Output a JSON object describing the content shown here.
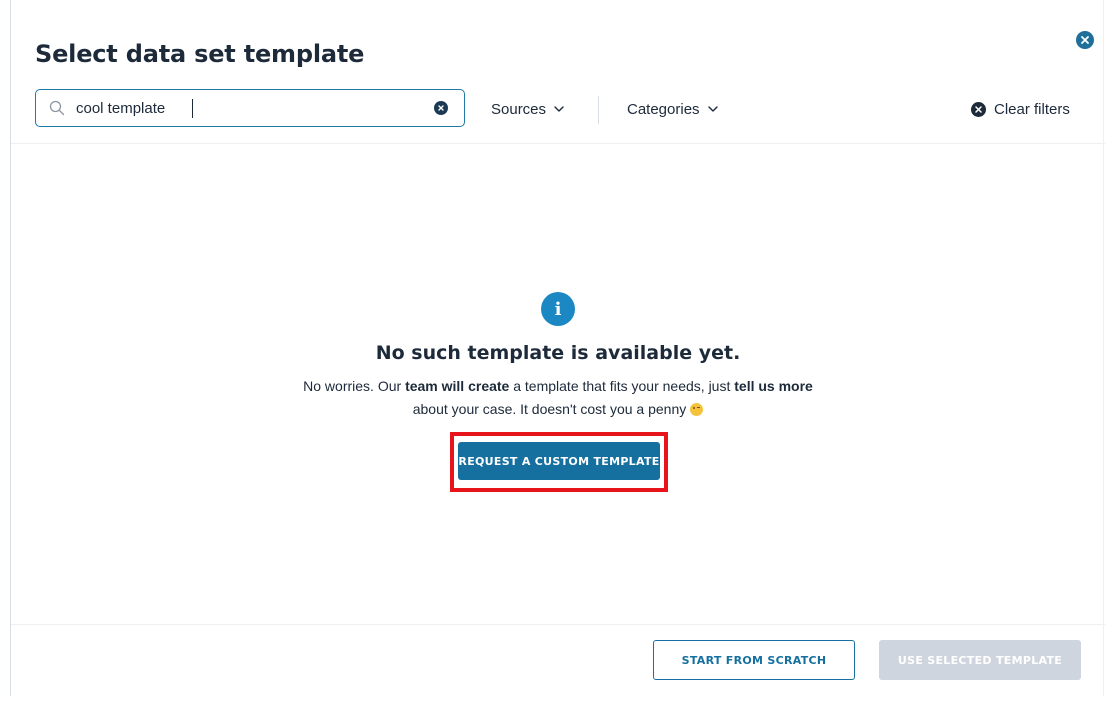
{
  "modal": {
    "title": "Select data set template",
    "close_icon": "close-circle-icon"
  },
  "search": {
    "value": "cool template",
    "placeholder": "",
    "icon": "search-icon",
    "clear_icon": "clear-circle-icon"
  },
  "filters": {
    "sources_label": "Sources",
    "categories_label": "Categories",
    "clear_filters_label": "Clear filters"
  },
  "empty_state": {
    "icon": "info-icon",
    "icon_glyph": "i",
    "heading": "No such template is available yet.",
    "line1_pre": "No worries. Our ",
    "line1_bold1": "team will create",
    "line1_mid": " a template that fits your needs, just ",
    "line1_bold2": "tell us more",
    "line2": "about your case. It doesn't cost you a penny",
    "emoji": "winking-face-emoji",
    "request_button": "REQUEST A CUSTOM TEMPLATE"
  },
  "footer": {
    "start_from_scratch": "START FROM SCRATCH",
    "use_selected_template": "USE SELECTED TEMPLATE"
  },
  "colors": {
    "primary": "#1570a0",
    "info": "#1b88c4",
    "highlight": "#e8141b",
    "disabled": "#cfd5de",
    "text": "#1d2a3a"
  }
}
